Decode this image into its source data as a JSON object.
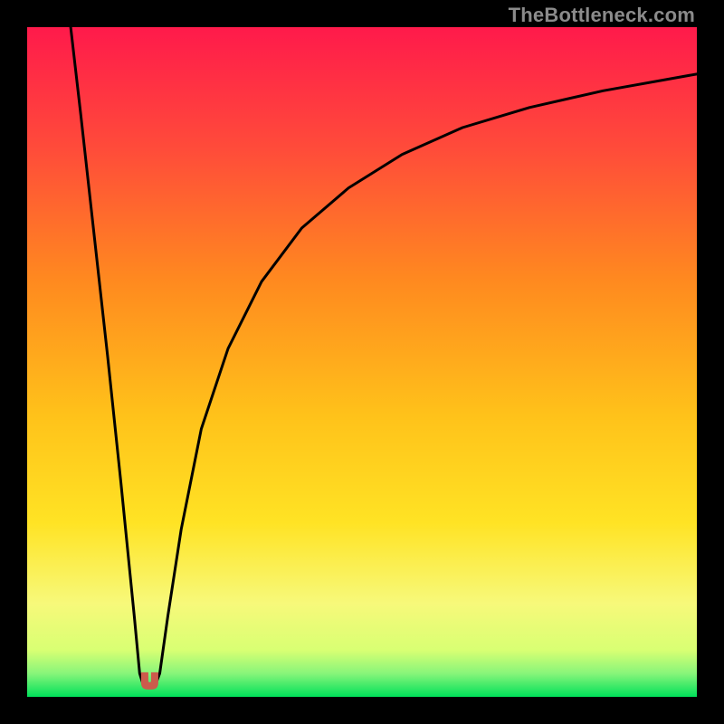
{
  "attribution": "TheBottleneck.com",
  "chart_data": {
    "type": "line",
    "title": "",
    "xlabel": "",
    "ylabel": "",
    "xlim": [
      0,
      100
    ],
    "ylim": [
      0,
      100
    ],
    "grid": false,
    "legend": false,
    "background_gradient": {
      "top": "#ff1a4b",
      "upper_mid": "#ff8a1f",
      "mid": "#ffd700",
      "lower_mid": "#f7f97a",
      "bottom": "#00e05a"
    },
    "series": [
      {
        "name": "left-branch",
        "x": [
          6.5,
          8.0,
          10.0,
          12.0,
          14.0,
          15.0,
          16.0,
          16.8
        ],
        "y": [
          100,
          87,
          69,
          51,
          32,
          22,
          12,
          3.5
        ]
      },
      {
        "name": "valley-floor",
        "x": [
          16.8,
          17.2,
          17.8,
          18.3,
          18.8,
          19.3,
          19.8
        ],
        "y": [
          3.5,
          2.2,
          1.8,
          1.7,
          1.8,
          2.2,
          3.5
        ]
      },
      {
        "name": "right-branch",
        "x": [
          19.8,
          21,
          23,
          26,
          30,
          35,
          41,
          48,
          56,
          65,
          75,
          86,
          100
        ],
        "y": [
          3.5,
          12,
          25,
          40,
          52,
          62,
          70,
          76,
          81,
          85,
          88,
          90.5,
          93
        ]
      }
    ],
    "minimum_marker": {
      "x": 18.3,
      "y": 1.7,
      "color": "#cc5b4c"
    }
  }
}
